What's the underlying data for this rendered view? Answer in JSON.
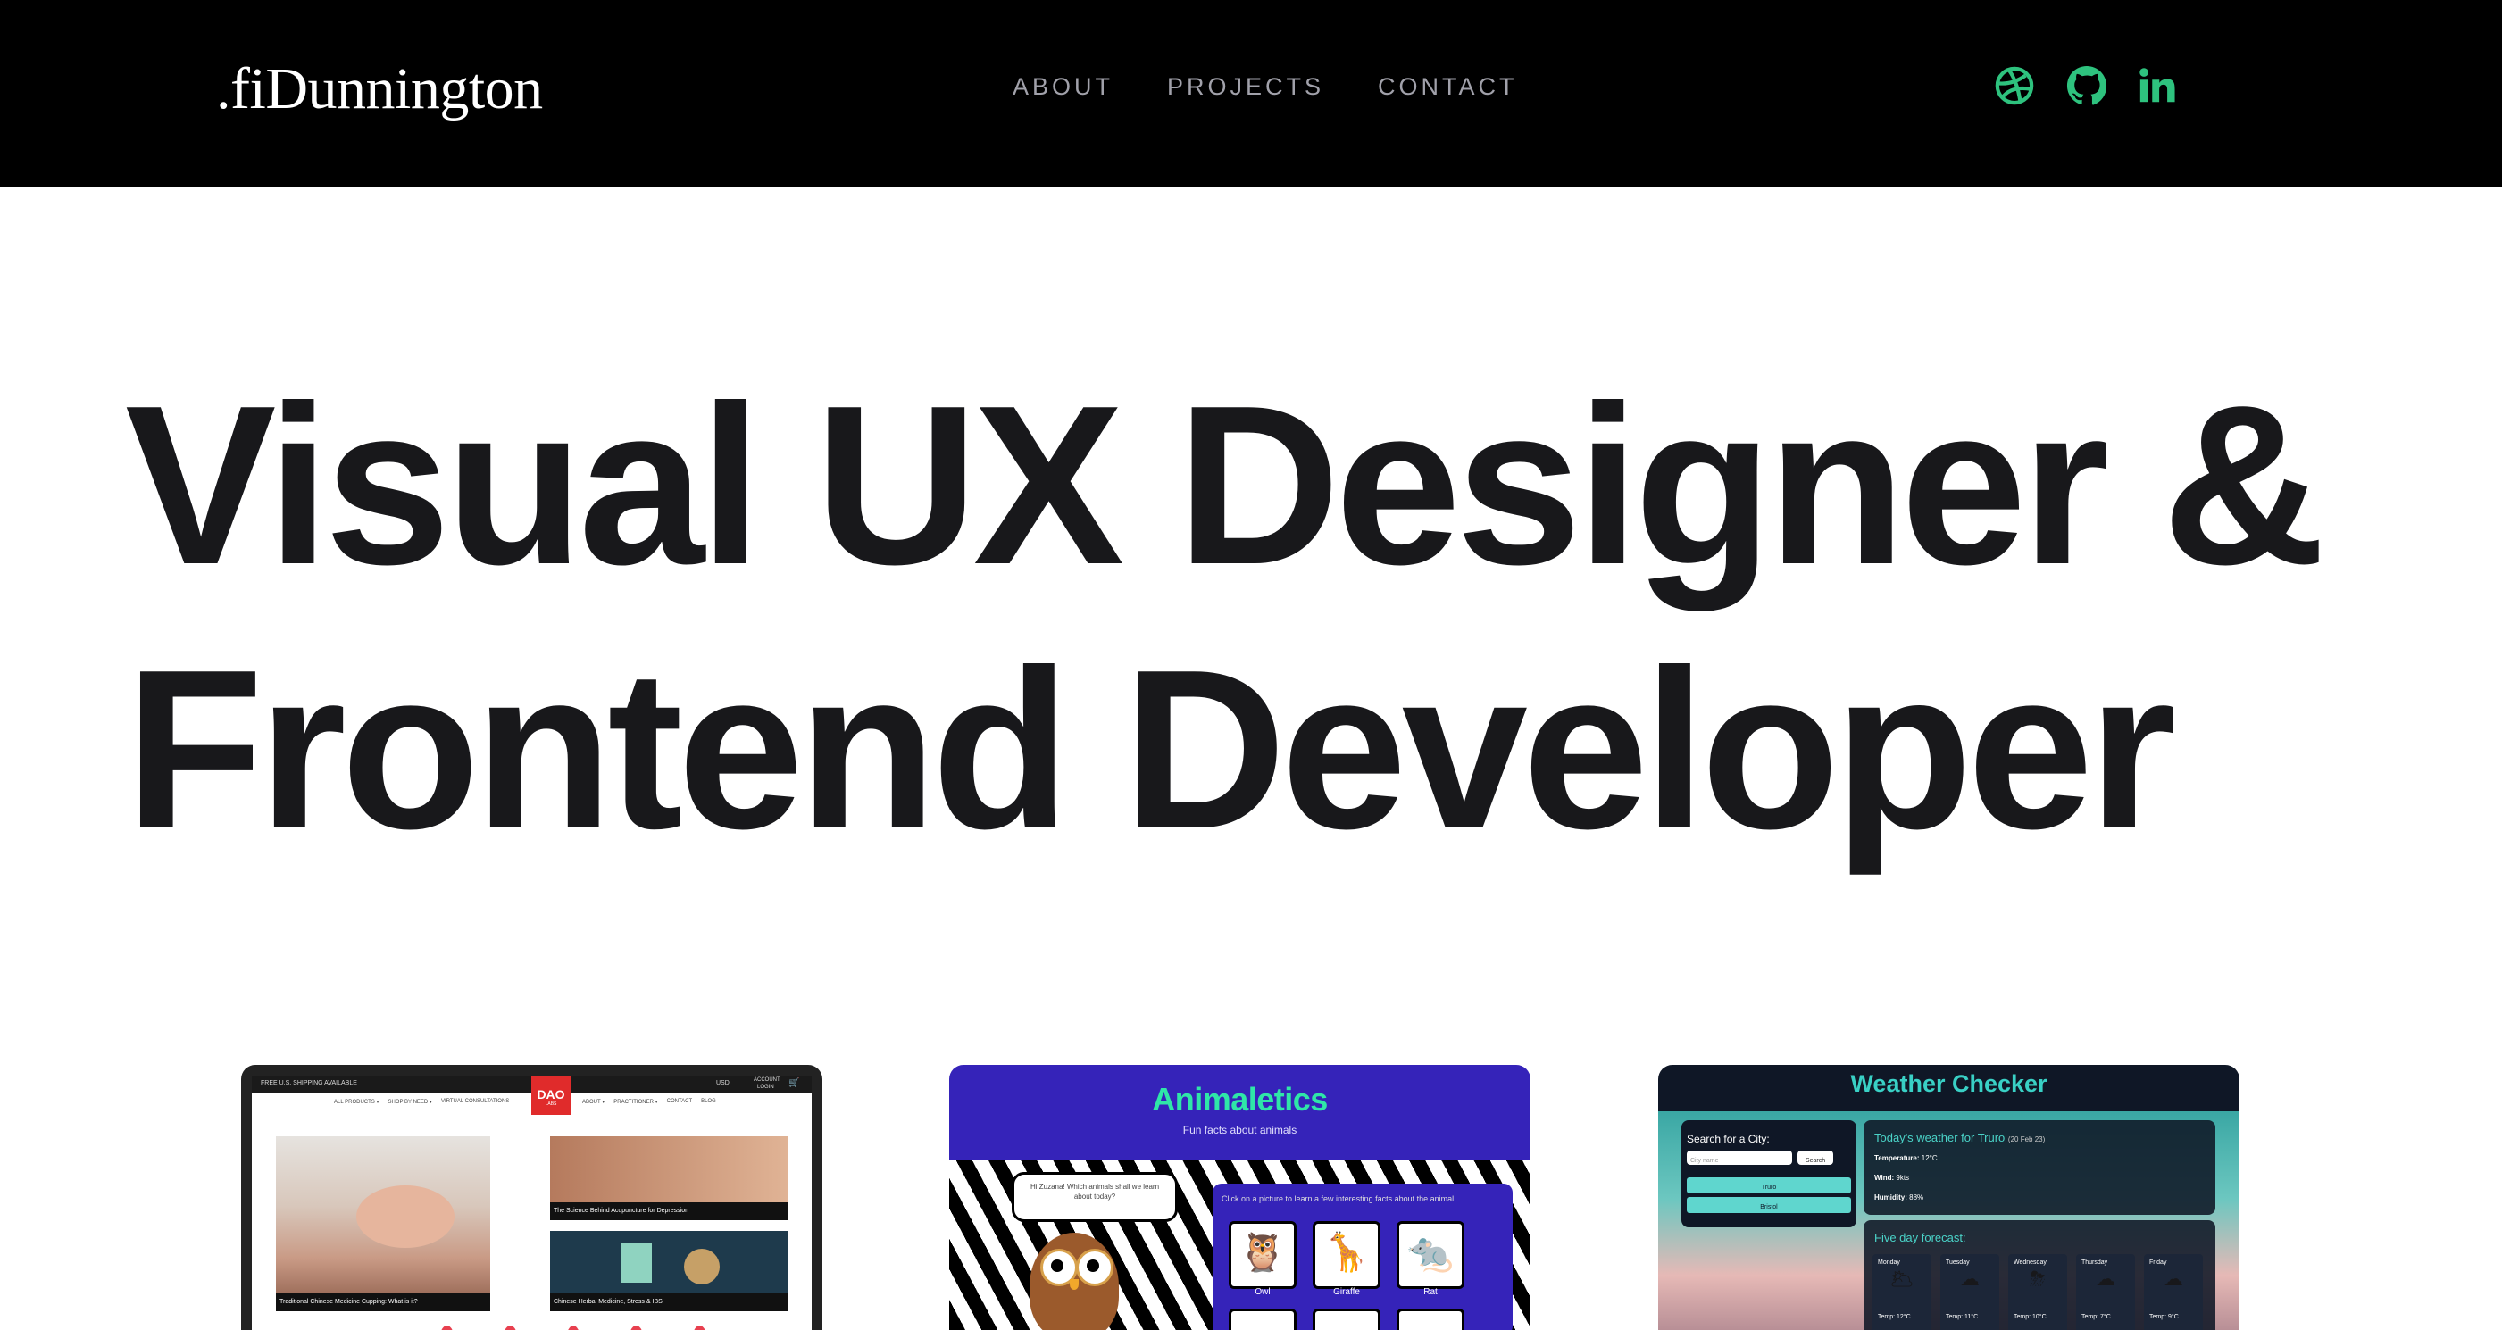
{
  "header": {
    "logo": ".fiDunnington",
    "nav": [
      "ABOUT",
      "PROJECTS",
      "CONTACT"
    ],
    "social_icons": [
      "dribbble-icon",
      "github-icon",
      "linkedin-icon"
    ],
    "accent_color": "#2ec27e"
  },
  "hero": {
    "line1": "Visual UX Designer &",
    "line2": "Frontend Developer"
  },
  "projects": [
    {
      "name": "dao-labs-site",
      "topbar": {
        "shipping": "FREE U.S. SHIPPING AVAILABLE",
        "currency": "USD",
        "account": "ACCOUNT",
        "login": "LOGIN"
      },
      "brand": "DAO",
      "brand_sub": "LABS",
      "menu": [
        "ALL PRODUCTS ▾",
        "SHOP BY NEED ▾",
        "VIRTUAL CONSULTATIONS",
        "ABOUT ▾",
        "PRACTITIONER ▾",
        "CONTACT",
        "BLOG"
      ],
      "articles": [
        "Traditional Chinese Medicine Cupping: What is it?",
        "The Science Behind Acupuncture for Depression",
        "Chinese Herbal Medicine, Stress & IBS"
      ]
    },
    {
      "name": "animaletics",
      "title": "Animaletics",
      "subtitle": "Fun facts about animals",
      "speech": "Hi Zuzana! Which animals shall we learn about today?",
      "instruction": "Click on a picture to learn a few interesting facts about the animal",
      "animals": [
        "Owl",
        "Giraffe",
        "Rat"
      ]
    },
    {
      "name": "weather-checker",
      "title": "Weather Checker",
      "search_label": "Search for a City:",
      "search_placeholder": "City name",
      "search_button": "Search",
      "recent_cities": [
        "Truro",
        "Bristol"
      ],
      "today_heading": "Today's weather for Truro",
      "today_date": "(20 Feb 23)",
      "temperature_label": "Temperature:",
      "temperature": "12°C",
      "wind_label": "Wind:",
      "wind": "9kts",
      "humidity_label": "Humidity:",
      "humidity": "88%",
      "forecast_heading": "Five day forecast:",
      "forecast": [
        {
          "day": "Monday",
          "temp": "Temp: 12°C"
        },
        {
          "day": "Tuesday",
          "temp": "Temp: 11°C"
        },
        {
          "day": "Wednesday",
          "temp": "Temp: 10°C"
        },
        {
          "day": "Thursday",
          "temp": "Temp: 7°C"
        },
        {
          "day": "Friday",
          "temp": "Temp: 9°C"
        }
      ]
    }
  ]
}
